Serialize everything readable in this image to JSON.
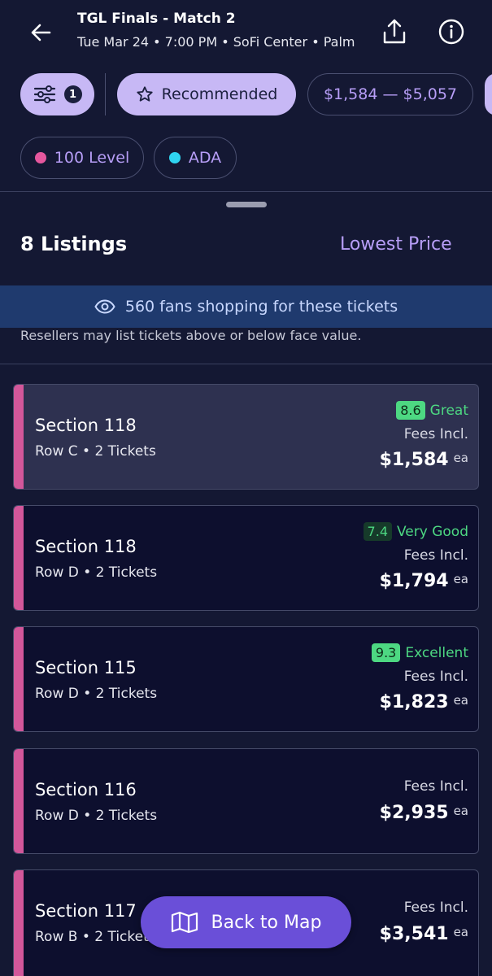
{
  "header": {
    "title": "TGL Finals - Match 2",
    "subtitle": "Tue Mar 24 • 7:00 PM • SoFi Center • Palm"
  },
  "filters": {
    "count": "1",
    "recommended_label": "Recommended",
    "price_range": "$1,584 — $5,057",
    "chips": [
      {
        "label": "100 Level",
        "dot_color": "#e5579e"
      },
      {
        "label": "ADA",
        "dot_color": "#2fd4f0"
      }
    ]
  },
  "listings": {
    "count_label": "8 Listings",
    "sort_label": "Lowest Price",
    "banner_text": "560 fans shopping for these tickets",
    "disclaimer": "Resellers may list tickets above or below face value.",
    "items": [
      {
        "section": "Section 118",
        "row": "Row C • 2 Tickets",
        "score": "8.6",
        "rating": "Great",
        "fees": "Fees Incl.",
        "price": "$1,584",
        "unit": "ea"
      },
      {
        "section": "Section 118",
        "row": "Row D • 2 Tickets",
        "score": "7.4",
        "rating": "Very Good",
        "fees": "Fees Incl.",
        "price": "$1,794",
        "unit": "ea"
      },
      {
        "section": "Section 115",
        "row": "Row D • 2 Tickets",
        "score": "9.3",
        "rating": "Excellent",
        "fees": "Fees Incl.",
        "price": "$1,823",
        "unit": "ea"
      },
      {
        "section": "Section 116",
        "row": "Row D • 2 Tickets",
        "fees": "Fees Incl.",
        "price": "$2,935",
        "unit": "ea"
      },
      {
        "section": "Section 117",
        "row": "Row B • 2 Tickets",
        "fees": "Fees Incl.",
        "price": "$3,541",
        "unit": "ea"
      }
    ]
  },
  "map_button_label": "Back to Map",
  "colors": {
    "background": "#141833",
    "accent_purple": "#c7b8f5",
    "link_purple": "#b79ef7",
    "rating_green": "#4dd882",
    "card_accent": "#d2579a",
    "map_button": "#6a4fd8"
  }
}
